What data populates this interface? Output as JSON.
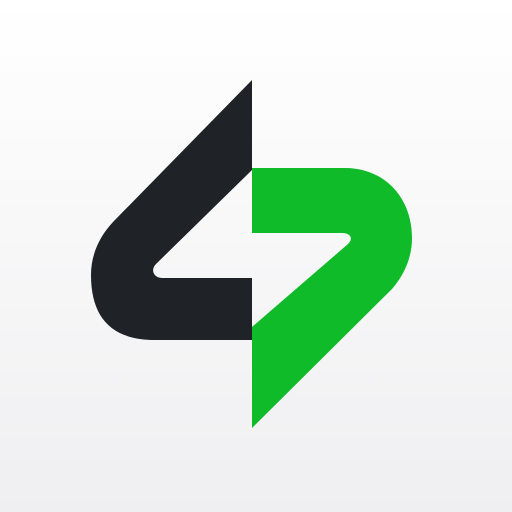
{
  "logo": {
    "icon": "bolt-split-mark-icon",
    "colors": {
      "dark_half": "#1f2226",
      "green_half": "#10bb2a",
      "background_top": "#ffffff",
      "background_bottom": "#efeff1"
    }
  }
}
